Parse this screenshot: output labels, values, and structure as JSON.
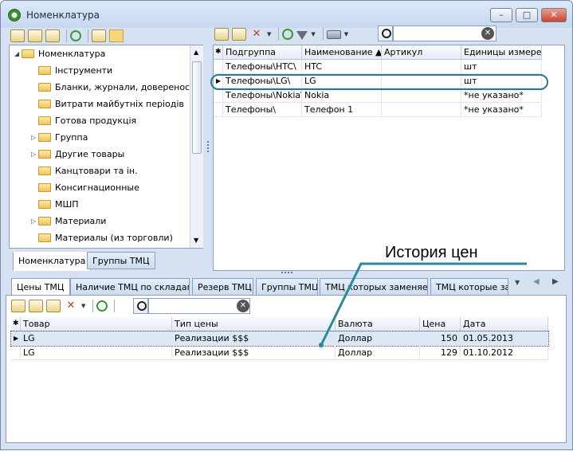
{
  "window": {
    "title": "Номенклатура",
    "min": "–",
    "max": "□",
    "close": "✕"
  },
  "tree": {
    "items": [
      {
        "label": "Номенклатура",
        "level": 0,
        "expander": "◢"
      },
      {
        "label": "Інструменти",
        "level": 1,
        "expander": ""
      },
      {
        "label": "Бланки, журнали, довереності",
        "level": 1,
        "expander": ""
      },
      {
        "label": "Витрати майбутніх періодів",
        "level": 1,
        "expander": ""
      },
      {
        "label": "Готова продукція",
        "level": 1,
        "expander": ""
      },
      {
        "label": "Группа",
        "level": 1,
        "expander": "▷"
      },
      {
        "label": "Другие товары",
        "level": 1,
        "expander": "▷"
      },
      {
        "label": "Канцтовари та ін.",
        "level": 1,
        "expander": ""
      },
      {
        "label": "Консигнационные",
        "level": 1,
        "expander": ""
      },
      {
        "label": "МШП",
        "level": 1,
        "expander": ""
      },
      {
        "label": "Материали",
        "level": 1,
        "expander": "▷"
      },
      {
        "label": "Материалы (из торговли)",
        "level": 1,
        "expander": ""
      }
    ],
    "tabs": [
      "Номенклатура",
      "Группы ТМЦ"
    ]
  },
  "items_grid": {
    "headers": [
      "Подгруппа",
      "Наименование ▲",
      "Артикул",
      "Единицы измерения"
    ],
    "rows": [
      [
        "Телефоны\\HTC\\",
        "HTC",
        "",
        "шт"
      ],
      [
        "Телефоны\\LG\\",
        "LG",
        "",
        "шт"
      ],
      [
        "Телефоны\\Nokia\\",
        "Nokia",
        "",
        "*не указано*"
      ],
      [
        "Телефоны\\",
        "Телефон 1",
        "",
        "*не указано*"
      ]
    ],
    "selected_row": 1
  },
  "bottom_tabs": [
    "Цены ТМЦ",
    "Наличие ТМЦ по складам",
    "Резерв ТМЦ",
    "Группы ТМЦ",
    "ТМЦ которых заменяет",
    "ТМЦ которые заме"
  ],
  "prices_grid": {
    "headers": [
      "Товар",
      "Тип цены",
      "Валюта",
      "Цена",
      "Дата"
    ],
    "rows": [
      [
        "LG",
        "Реализации $$$",
        "Доллар",
        "150",
        "01.05.2013"
      ],
      [
        "LG",
        "Реализации $$$",
        "Доллар",
        "129",
        "01.10.2012"
      ]
    ]
  },
  "callout": {
    "text": "История цен"
  },
  "accent": "#2a8a9a"
}
